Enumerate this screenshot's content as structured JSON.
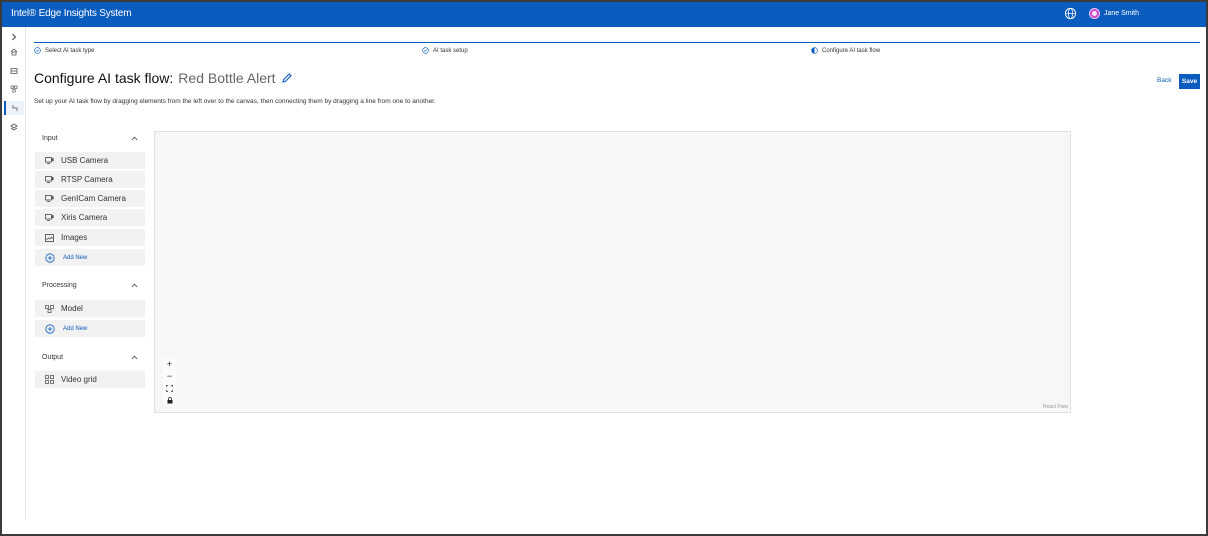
{
  "header": {
    "app_title": "Intel® Edge Insights System",
    "user_name": "Jane Smith",
    "brand_color": "#0b5cbf",
    "icons": [
      "globe-icon",
      "user-avatar"
    ]
  },
  "rail": {
    "icons": [
      "chevron-right-icon",
      "home-icon",
      "layout-icon",
      "model-icon",
      "flow-icon",
      "layers-icon"
    ]
  },
  "stepper": {
    "steps": [
      {
        "label": "Select AI task type",
        "status": "done"
      },
      {
        "label": "AI task setup",
        "status": "done"
      },
      {
        "label": "Configure AI task flow",
        "status": "current"
      }
    ]
  },
  "page": {
    "title": "Configure AI task flow:",
    "flow_name": "Red Bottle Alert",
    "description": "Set up your AI task flow by dragging elements from the left over to the canvas, then connecting them by dragging a line from one to another.",
    "back_label": "Back",
    "save_label": "Save"
  },
  "palette": {
    "input": {
      "label": "Input",
      "items": [
        {
          "label": "USB Camera",
          "icon": "camera-icon"
        },
        {
          "label": "RTSP Camera",
          "icon": "camera-icon"
        },
        {
          "label": "GenICam Camera",
          "icon": "camera-icon"
        },
        {
          "label": "Xiris Camera",
          "icon": "camera-icon"
        },
        {
          "label": "Images",
          "icon": "image-icon"
        }
      ],
      "add_label": "Add New"
    },
    "processing": {
      "label": "Processing",
      "items": [
        {
          "label": "Model",
          "icon": "model-icon"
        }
      ],
      "add_label": "Add New"
    },
    "output": {
      "label": "Output",
      "items": [
        {
          "label": "Video grid",
          "icon": "grid-icon"
        }
      ]
    }
  },
  "canvas": {
    "controls": [
      "+",
      "−",
      "fit-view",
      "lock"
    ],
    "attribution": "React Flow"
  }
}
